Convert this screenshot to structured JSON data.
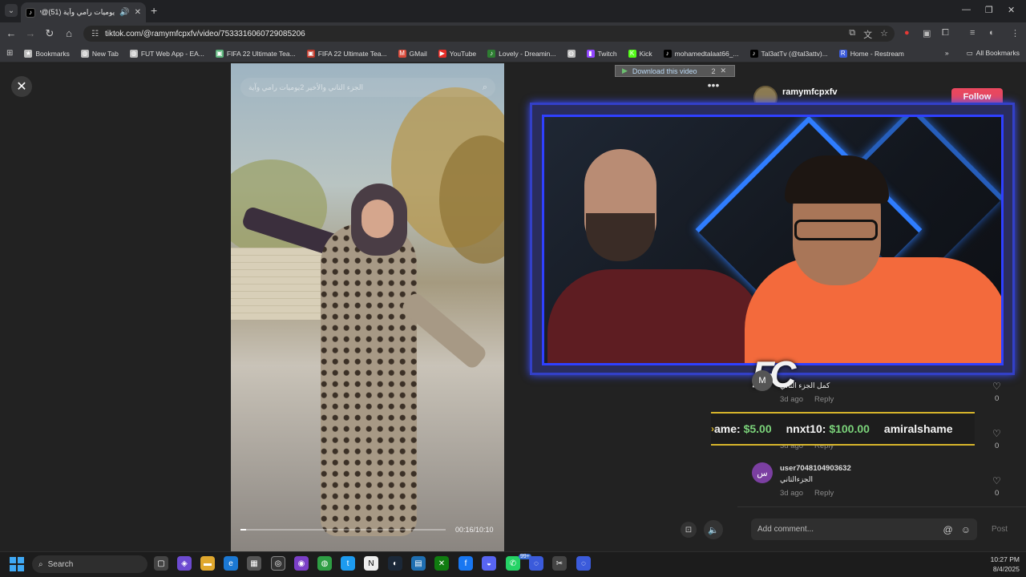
{
  "browser": {
    "tab_title": "يوميات رامي وآية (51)@‏cfv",
    "address": "tiktok.com/@ramymfcpxfv/video/7533316060729085206",
    "bookmarks": [
      {
        "label": "Bookmarks",
        "icon": "star-icon",
        "color": "#bbbbbb"
      },
      {
        "label": "New Tab",
        "icon": "globe-icon",
        "color": "#bbbbbb"
      },
      {
        "label": "FUT Web App - EA...",
        "icon": "globe-icon",
        "color": "#bbbbbb"
      },
      {
        "label": "FIFA 22 Ultimate Tea...",
        "icon": "fifa-icon",
        "color": "#5bb27a"
      },
      {
        "label": "FIFA 22 Ultimate Tea...",
        "icon": "fifa-icon",
        "color": "#c0392b"
      },
      {
        "label": "GMail",
        "icon": "gmail-icon",
        "color": "#d64a3b"
      },
      {
        "label": "YouTube",
        "icon": "youtube-icon",
        "color": "#e52d27"
      },
      {
        "label": "Lovely - Dreamin...",
        "icon": "music-icon",
        "color": "#2e7d32"
      },
      {
        "label": "",
        "icon": "globe-icon",
        "color": "#bbbbbb"
      },
      {
        "label": "Twitch",
        "icon": "twitch-icon",
        "color": "#9146ff"
      },
      {
        "label": "Kick",
        "icon": "kick-icon",
        "color": "#53fc18"
      },
      {
        "label": "mohamedtalaat66_...",
        "icon": "tiktok-icon",
        "color": "#000000"
      },
      {
        "label": "Tal3atTv (@tal3attv)...",
        "icon": "tiktok-icon",
        "color": "#000000"
      },
      {
        "label": "Home - Restream",
        "icon": "restream-icon",
        "color": "#3b5bdb"
      }
    ],
    "all_bookmarks": "All Bookmarks"
  },
  "video": {
    "search_placeholder": "الجزء التاني والأخير 2يوميات رامي وآية",
    "time": "00:16/10:10",
    "progress_fraction": 0.027
  },
  "download_bar": {
    "label": "Download this video",
    "count": "2"
  },
  "author": {
    "name": "ramymfcpxfv",
    "follow_label": "Follow"
  },
  "overlay": {
    "logo": "FC"
  },
  "ticker": {
    "items": [
      {
        "name": "ame:",
        "amount": "$5.00"
      },
      {
        "name": "nnxt10:",
        "amount": "$100.00"
      },
      {
        "name": "amiralshame",
        "amount": ""
      }
    ]
  },
  "comments": [
    {
      "avatar": "M",
      "avatar_color": "#555555",
      "user": "",
      "text": "كمل الجزء التاني",
      "age": "3d ago",
      "reply": "Reply",
      "likes": "0"
    },
    {
      "avatar": "",
      "avatar_color": "#555555",
      "user": "",
      "text": "",
      "age": "3d ago",
      "reply": "Reply",
      "likes": "0"
    },
    {
      "avatar": "س",
      "avatar_color": "#7b3fa1",
      "user": "user7048104903632",
      "text": "الجزءالتاني",
      "age": "3d ago",
      "reply": "Reply",
      "likes": "0"
    }
  ],
  "comment_input": {
    "placeholder": "Add comment...",
    "post_label": "Post"
  },
  "taskbar": {
    "search_label": "Search",
    "badge": "99+",
    "time": "10:27 PM",
    "date": "8/4/2025"
  }
}
